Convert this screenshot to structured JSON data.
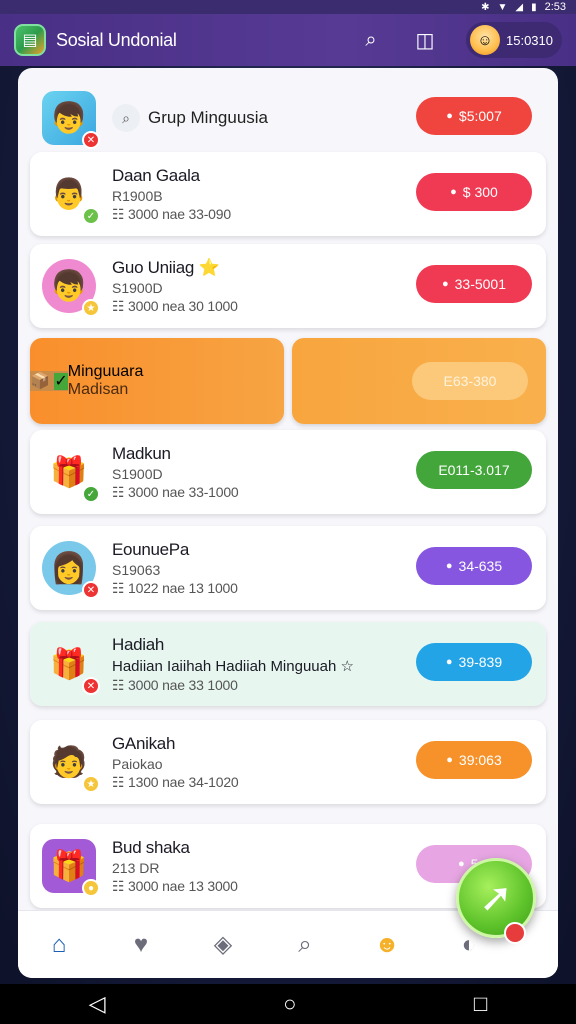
{
  "status_bar": {
    "time": "2:53"
  },
  "app_bar": {
    "title": "Sosial Undonial",
    "user_code": "15:0310"
  },
  "header": {
    "title": "Grup Minguusia",
    "badge": "$5:007"
  },
  "rows": [
    {
      "name": "Daan Gaala",
      "sub": "R1900B",
      "meta": "☷ 3000 nae 33-090",
      "badge": "$ 300",
      "color": "#f03a53",
      "avatar_icon": "👨"
    },
    {
      "name": "Guo Uniiag ⭐",
      "sub": "S1900D",
      "meta": "☷ 3000 nea 30 1000",
      "badge": "33-5001",
      "color": "#f03a53",
      "avatar_icon": "👦"
    },
    {
      "name": "Madkun",
      "sub": "S1900D",
      "meta": "☷ 3000 nae 33-1000",
      "badge": "E011-3.017",
      "color": "#43a63a",
      "avatar_icon": "🎁"
    },
    {
      "name": "EounuePa",
      "sub": "S19063",
      "meta": "☷ 1022 nae 13 1000",
      "badge": "34-635",
      "color": "#8656e0",
      "avatar_icon": "👩"
    },
    {
      "name": "Hadiah",
      "sub": "Hadiian Iaiihah Hadiiah Minguuah ☆",
      "meta": "☷ 3000 nae 33 1000",
      "badge": "39-839",
      "color": "#23a4e6",
      "avatar_icon": "🎁"
    },
    {
      "name": "GAnikah",
      "sub": "Paiokao",
      "meta": "☷ 1300 nae 34-1020",
      "badge": "39:063",
      "color": "#f7922a",
      "avatar_icon": "🧑"
    },
    {
      "name": "Bud shaka",
      "sub": "213 DR",
      "meta": "☷ 3000 nae 13 3000",
      "badge": "5:0",
      "color": "#e7a6e3",
      "avatar_icon": "🎁"
    }
  ],
  "promo": {
    "name": "Minguuara",
    "sub": "Madisan",
    "badge": "E63-380"
  },
  "nav": {
    "items": [
      "home-icon",
      "gift-box-icon",
      "heart-shield-icon",
      "search-icon",
      "notification-icon",
      "profile-icon"
    ]
  }
}
